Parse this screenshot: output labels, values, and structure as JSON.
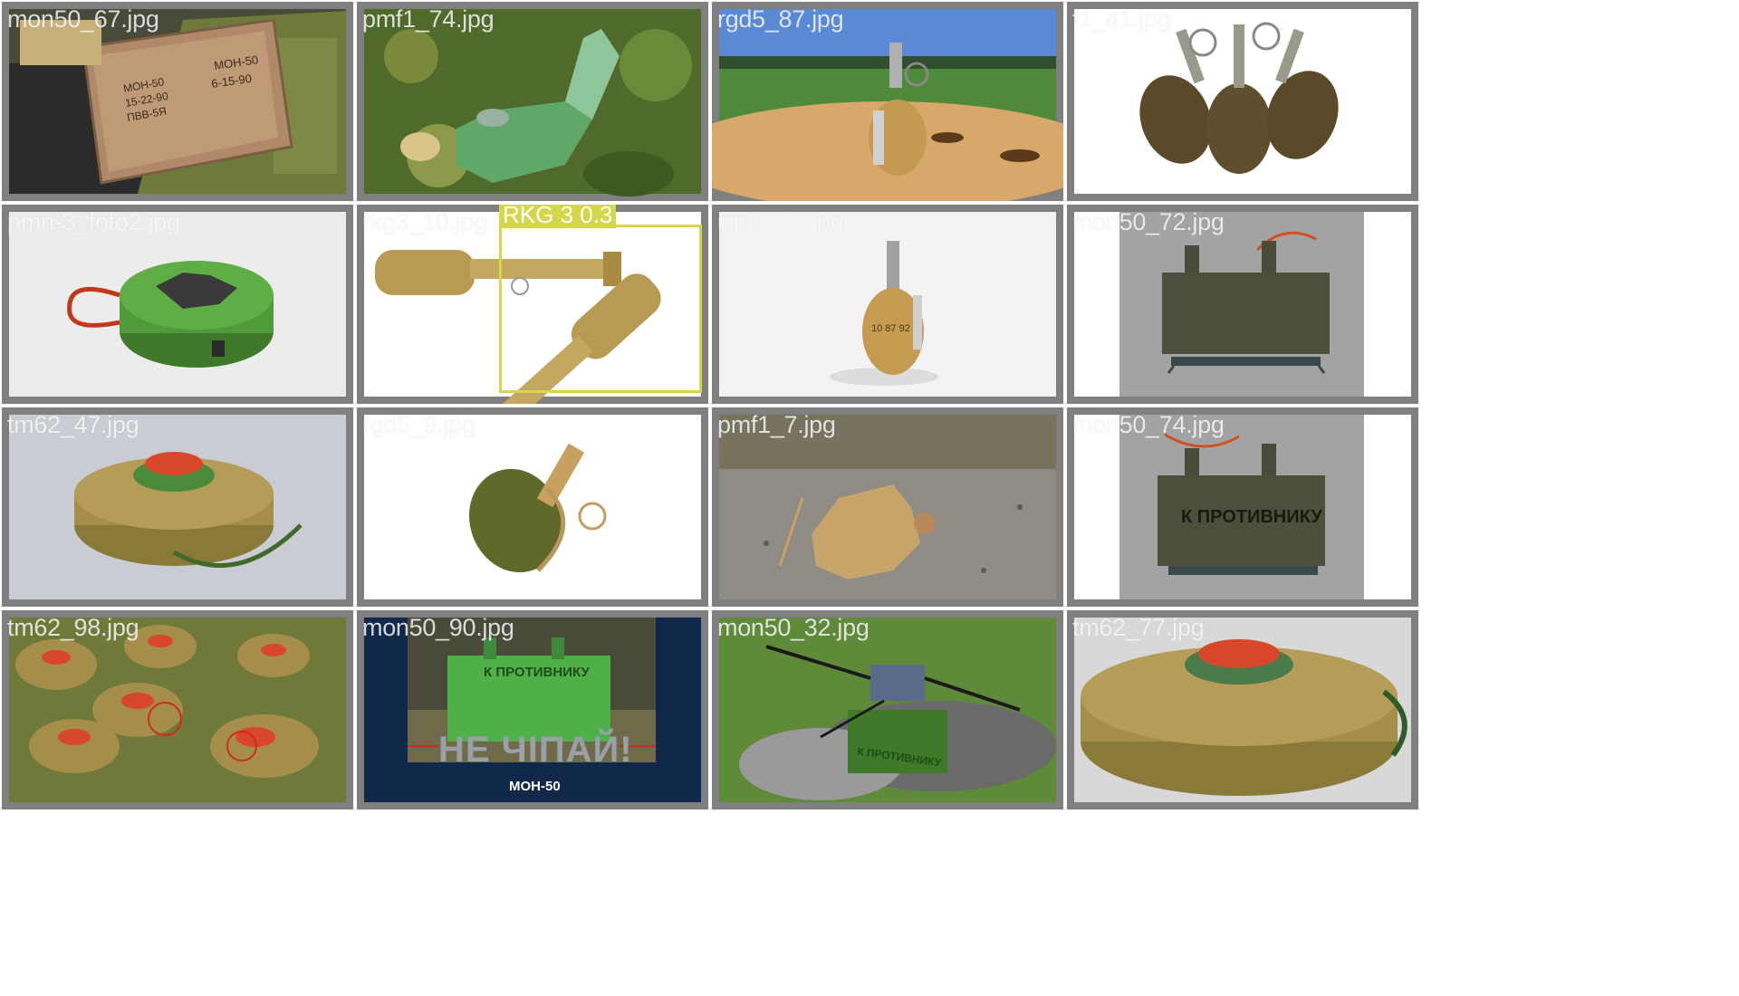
{
  "tiles": [
    {
      "file": "mon50_67.jpg"
    },
    {
      "file": "pmf1_74.jpg"
    },
    {
      "file": "rgd5_87.jpg"
    },
    {
      "file": "f1_41.jpg"
    },
    {
      "file": "pmn-3_foto2.jpg"
    },
    {
      "file": "rkg3_10.jpg",
      "detection": {
        "label": "RKG 3 0.3",
        "color": "#d6d64a"
      }
    },
    {
      "file": "rgd5_78.jpg"
    },
    {
      "file": "mon50_72.jpg"
    },
    {
      "file": "tm62_47.jpg"
    },
    {
      "file": "rgd5_9.jpg"
    },
    {
      "file": "pmf1_7.jpg"
    },
    {
      "file": "mon50_74.jpg",
      "printed_text": "К ПРОТИВНИКУ"
    },
    {
      "file": "tm62_98.jpg"
    },
    {
      "file": "mon50_90.jpg",
      "printed_text": "К ПРОТИВНИКУ",
      "banner": "НЕ ЧІПАЙ!",
      "caption": "МОН-50"
    },
    {
      "file": "mon50_32.jpg",
      "printed_text": "К ПРОТИВНИКУ"
    },
    {
      "file": "tm62_77.jpg"
    }
  ],
  "box_text": {
    "line1": "МОН-50",
    "line2": "6-15-90",
    "left1": "МОН-50",
    "left2": "15-22-90",
    "left3": "ПВВ-5Я",
    "marking": "10 87 92"
  },
  "colors": {
    "frame": "#7f7f7f",
    "label": "#ffffff",
    "detection": "#d6d64a",
    "olive": "#6f7a3a",
    "tan": "#b59a5a",
    "green": "#5c9a3c"
  }
}
